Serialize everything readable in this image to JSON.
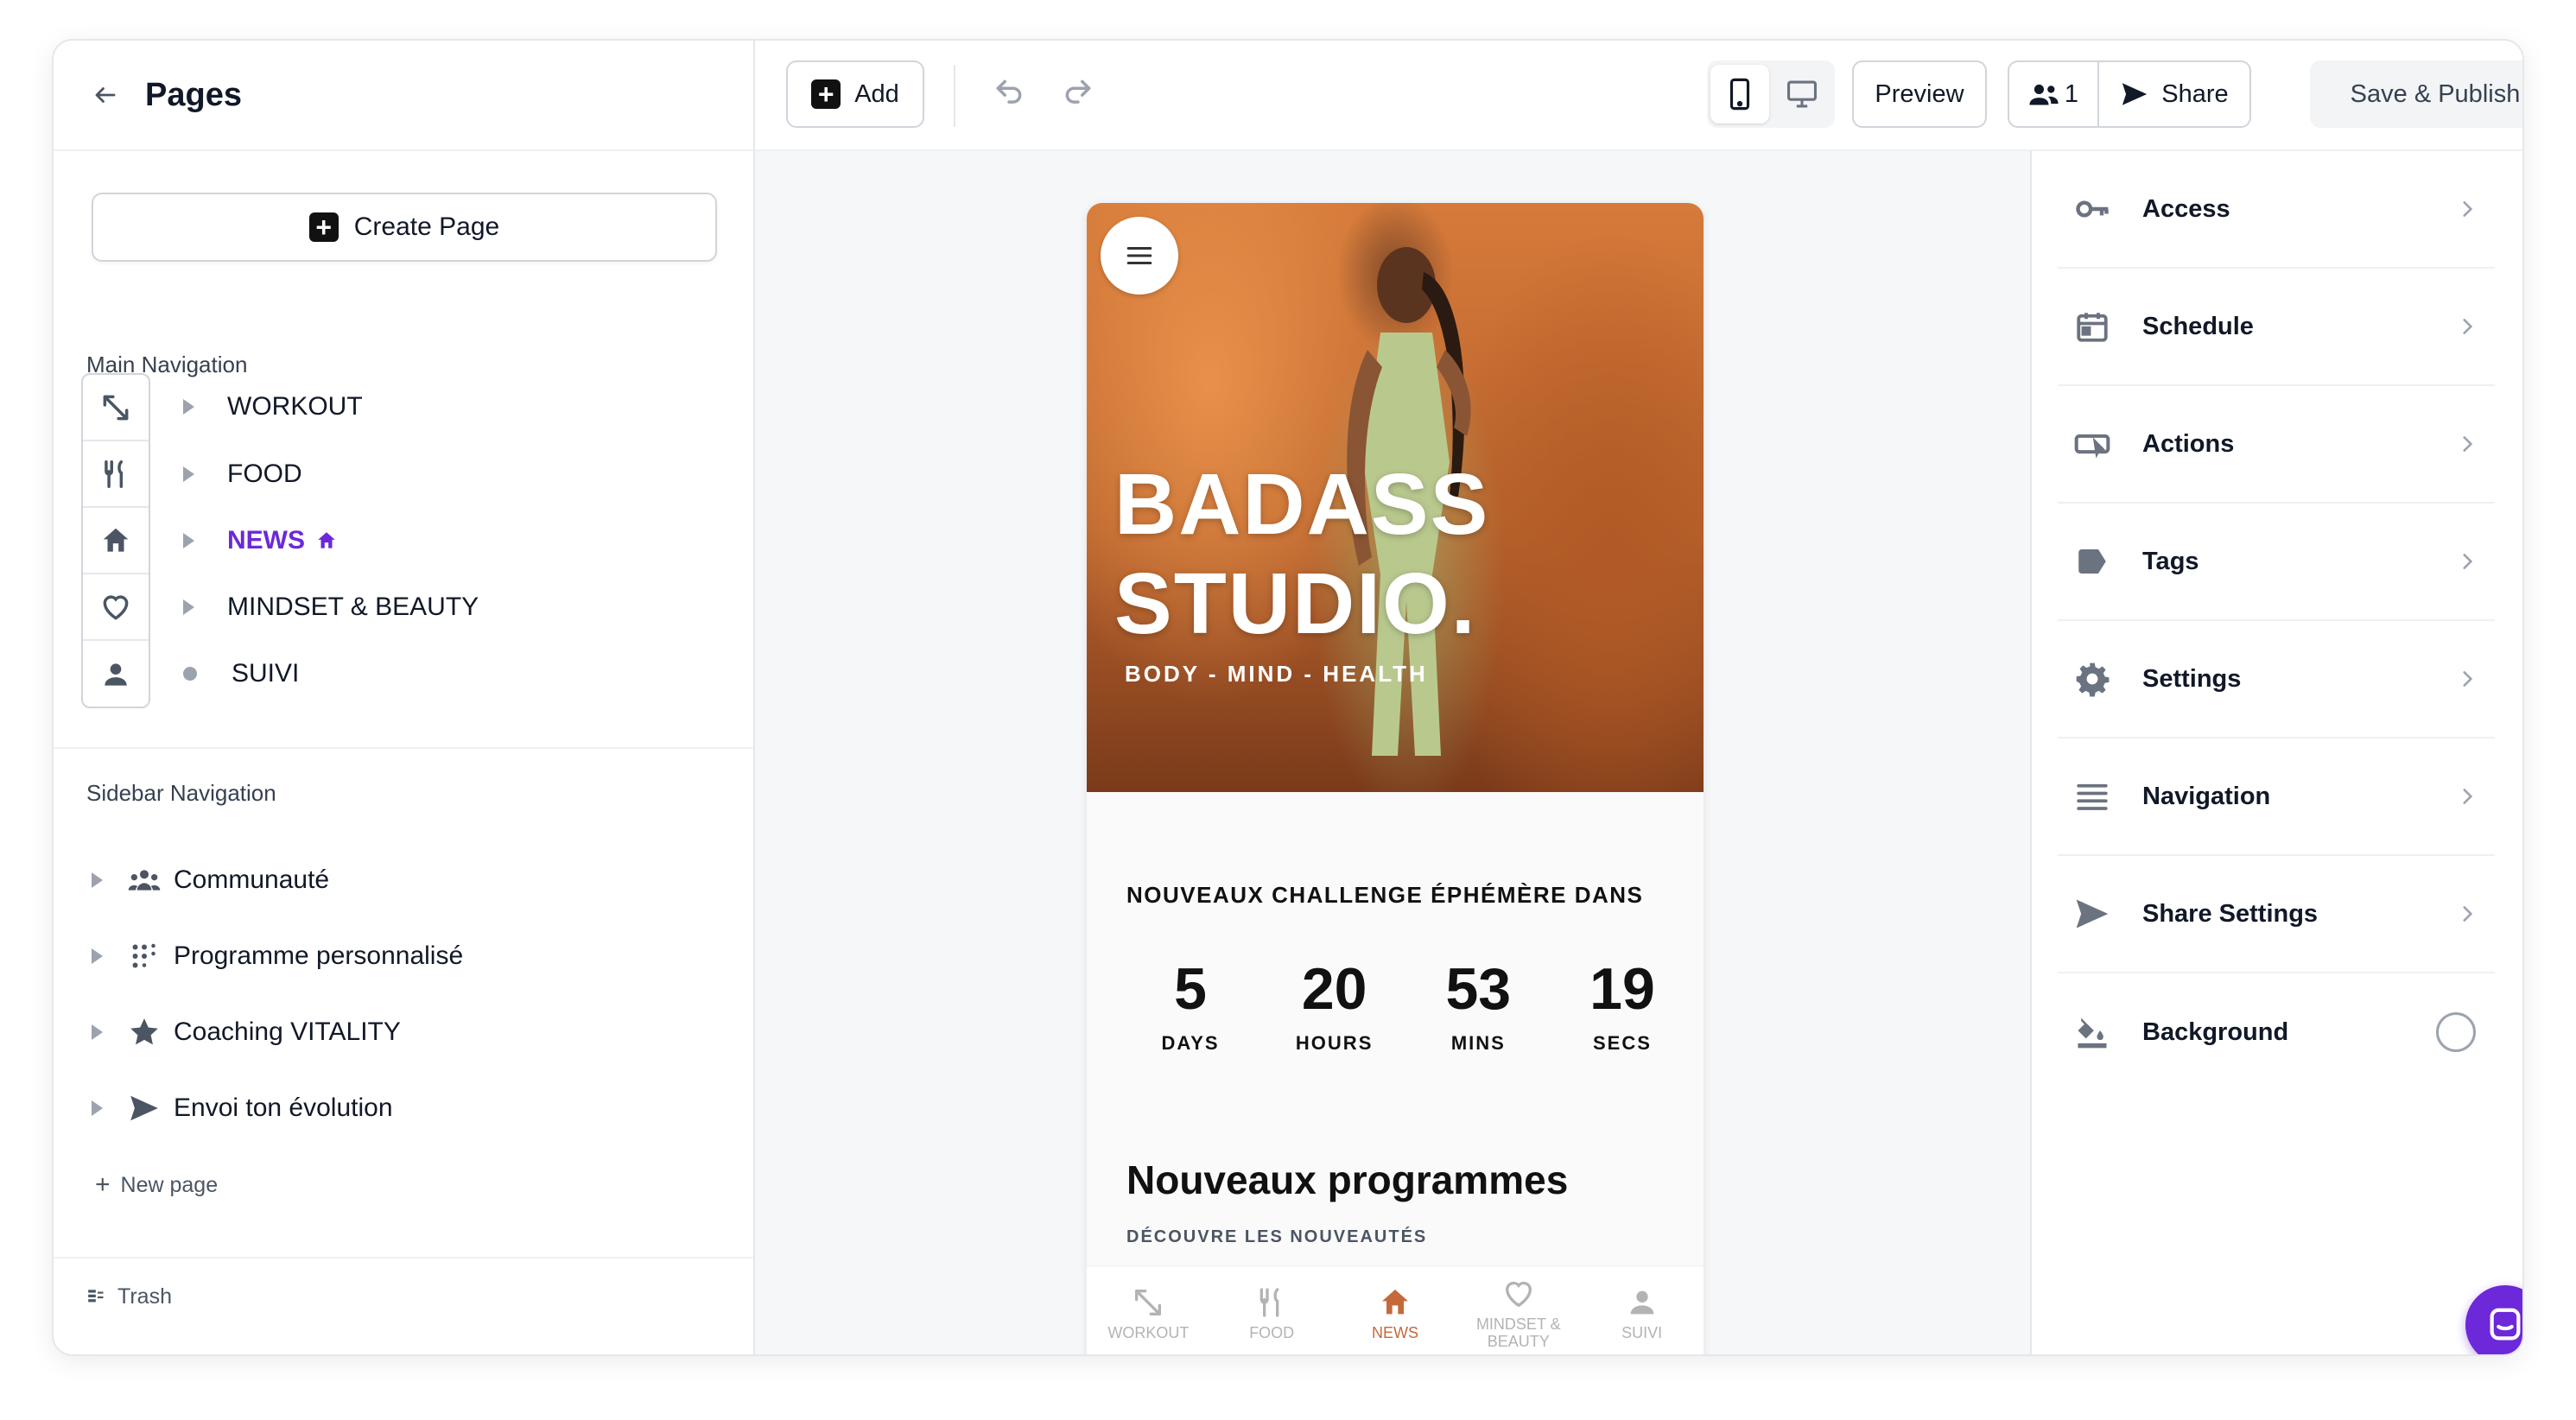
{
  "left_panel": {
    "title": "Pages",
    "create_page_label": "Create Page",
    "main_nav_label": "Main Navigation",
    "main_nav_items": [
      {
        "label": "WORKOUT",
        "icon": "expand-arrows-icon"
      },
      {
        "label": "FOOD",
        "icon": "fork-knife-icon"
      },
      {
        "label": "NEWS",
        "icon": "home-icon",
        "active": true
      },
      {
        "label": "MINDSET & BEAUTY",
        "icon": "heart-icon"
      },
      {
        "label": "SUIVI",
        "icon": "user-icon"
      }
    ],
    "sidebar_nav_label": "Sidebar Navigation",
    "sidebar_items": [
      {
        "label": "Communauté",
        "icon": "group-icon"
      },
      {
        "label": "Programme personnalisé",
        "icon": "dots-grid-icon"
      },
      {
        "label": "Coaching VITALITY",
        "icon": "star-icon"
      },
      {
        "label": "Envoi ton évolution",
        "icon": "send-icon"
      }
    ],
    "new_page_label": "New page",
    "trash_label": "Trash"
  },
  "toolbar": {
    "add_label": "Add",
    "preview_label": "Preview",
    "share_count": "1",
    "share_label": "Share",
    "publish_label": "Save & Publish"
  },
  "phone": {
    "hero_title": "BADASS\nSTUDIO.",
    "hero_subtitle": "BODY - MIND - HEALTH",
    "challenge_title": "NOUVEAUX CHALLENGE ÉPHÉMÈRE DANS",
    "countdown": [
      {
        "value": "5",
        "label": "DAYS"
      },
      {
        "value": "20",
        "label": "HOURS"
      },
      {
        "value": "53",
        "label": "MINS"
      },
      {
        "value": "19",
        "label": "SECS"
      }
    ],
    "programs_title": "Nouveaux programmes",
    "programs_subtitle": "DÉCOUVRE LES NOUVEAUTÉS",
    "bottom_nav": [
      {
        "label": "WORKOUT",
        "icon": "expand-arrows-icon"
      },
      {
        "label": "FOOD",
        "icon": "fork-knife-icon"
      },
      {
        "label": "NEWS",
        "icon": "home-icon",
        "active": true
      },
      {
        "label": "MINDSET & BEAUTY",
        "icon": "heart-icon"
      },
      {
        "label": "SUIVI",
        "icon": "user-icon"
      }
    ]
  },
  "right_panel": {
    "items": [
      {
        "label": "Access",
        "icon": "key-icon"
      },
      {
        "label": "Schedule",
        "icon": "calendar-icon"
      },
      {
        "label": "Actions",
        "icon": "action-cursor-icon"
      },
      {
        "label": "Tags",
        "icon": "tag-icon"
      },
      {
        "label": "Settings",
        "icon": "gear-icon"
      },
      {
        "label": "Navigation",
        "icon": "menu-lines-icon"
      },
      {
        "label": "Share Settings",
        "icon": "send-icon"
      },
      {
        "label": "Background",
        "icon": "paint-bucket-icon"
      }
    ]
  },
  "colors": {
    "accent": "#6d28d9",
    "active_tab": "#c46a3a"
  }
}
